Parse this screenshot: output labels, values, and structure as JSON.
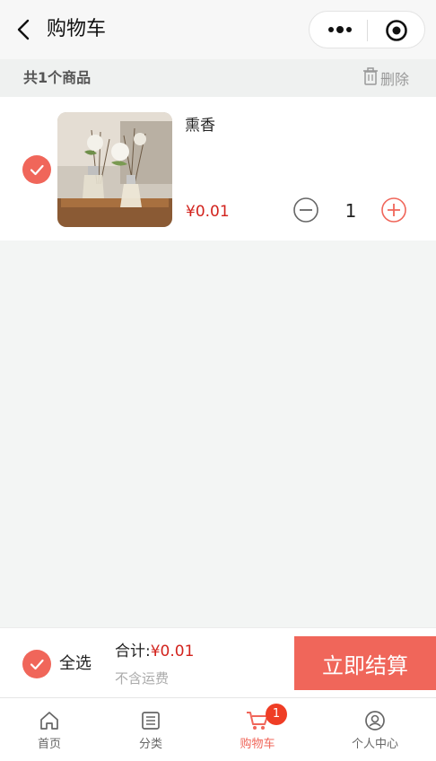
{
  "navbar": {
    "title": "购物车"
  },
  "summary": {
    "count_text": "共1个商品",
    "delete_label": "删除"
  },
  "cart": {
    "items": [
      {
        "name": "熏香",
        "price": "¥0.01",
        "quantity": "1",
        "checked": true
      }
    ]
  },
  "checkout": {
    "select_all_label": "全选",
    "total_label": "合计:",
    "total_value": "¥0.01",
    "shipping_note": "不含运费",
    "pay_button": "立即结算"
  },
  "tabbar": {
    "tabs": [
      {
        "label": "首页",
        "icon": "home-icon"
      },
      {
        "label": "分类",
        "icon": "category-list-icon"
      },
      {
        "label": "购物车",
        "icon": "cart-icon",
        "badge": "1",
        "active": true
      },
      {
        "label": "个人中心",
        "icon": "user-icon"
      }
    ]
  },
  "colors": {
    "accent": "#f0665a",
    "price": "#d2231d",
    "badge": "#ef3d25"
  }
}
